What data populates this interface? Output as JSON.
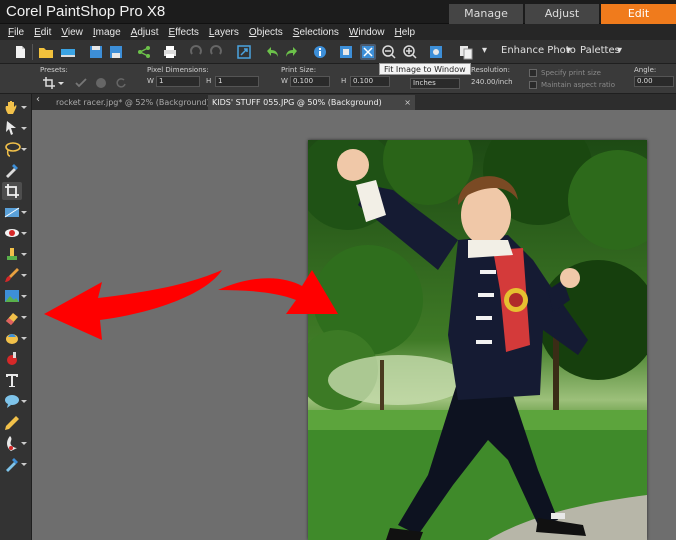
{
  "app": {
    "title": "Corel PaintShop Pro X8"
  },
  "workspaces": {
    "manage": "Manage",
    "adjust": "Adjust",
    "edit": "Edit"
  },
  "menu": [
    {
      "label": "File",
      "accel": "F",
      "rest": "ile"
    },
    {
      "label": "Edit",
      "accel": "E",
      "rest": "dit"
    },
    {
      "label": "View",
      "accel": "V",
      "rest": "iew"
    },
    {
      "label": "Image",
      "accel": "I",
      "rest": "mage"
    },
    {
      "label": "Adjust",
      "accel": "A",
      "rest": "djust"
    },
    {
      "label": "Effects",
      "accel": "E",
      "rest": "ffects"
    },
    {
      "label": "Layers",
      "accel": "L",
      "rest": "ayers"
    },
    {
      "label": "Objects",
      "accel": "O",
      "rest": "bjects"
    },
    {
      "label": "Selections",
      "accel": "S",
      "rest": "elections"
    },
    {
      "label": "Window",
      "accel": "W",
      "rest": "indow"
    },
    {
      "label": "Help",
      "accel": "H",
      "rest": "elp"
    }
  ],
  "toolbar": {
    "enhance_photo": "Enhance Photo",
    "palettes": "Palettes",
    "tooltip": "Fit Image to Window"
  },
  "options": {
    "presets_label": "Presets:",
    "pixel_dimensions_label": "Pixel Dimensions:",
    "w_label": "W",
    "w_value": "1",
    "h_label": "H",
    "h_value": "1",
    "print_size_label": "Print Size:",
    "print_w_label": "W",
    "print_w_value": "0.100",
    "print_h_label": "H",
    "print_h_value": "0.100",
    "units_value": "Inches",
    "resolution_label": "Resolution:",
    "resolution_value": "240.00/inch",
    "specify_print_size": "Specify print size",
    "maintain_aspect_ratio": "Maintain aspect ratio",
    "angle_label": "Angle:",
    "angle_value": "0.00"
  },
  "doc_tabs": [
    {
      "label": "rocket racer.jpg* @  52% (Background)"
    },
    {
      "label": "KIDS' STUFF 055.JPG @  50% (Background)"
    }
  ],
  "colors": {
    "accent": "#f07b1c",
    "workspace_bg": "#6e6e6e",
    "arrow": "#ff0000"
  }
}
